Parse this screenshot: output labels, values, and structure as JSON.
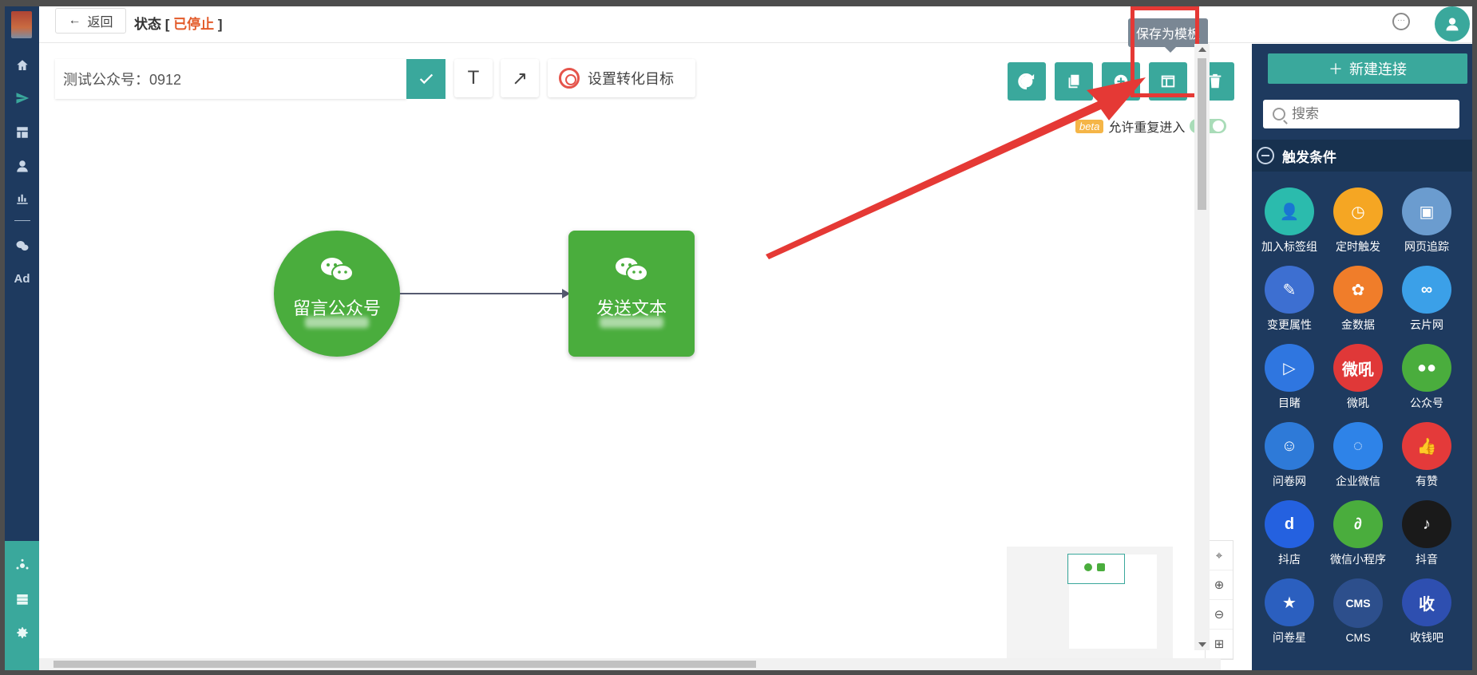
{
  "colors": {
    "primary": "#3aa89c",
    "sidebar": "#1e3a5f",
    "node_green": "#4aad3d",
    "status_stopped": "#e35b2a",
    "annotation_red": "#e53935"
  },
  "header": {
    "back_label": "返回",
    "status_prefix": "状态 [",
    "status_value": "已停止",
    "status_suffix": "]"
  },
  "left_nav": {
    "icons": [
      "home-icon",
      "send-icon",
      "layout-icon",
      "user-icon",
      "chart-icon",
      "wechat-icon",
      "ad-text",
      "hub-icon",
      "server-icon",
      "gear-icon"
    ],
    "ad_label": "Ad"
  },
  "toolbar": {
    "flow_name": "测试公众号：0912",
    "text_tool": "T",
    "arrow_tool": "↗",
    "goal_label": "设置转化目标",
    "tooltip": "保存为模板",
    "beta_badge": "beta",
    "reentry_label": "允许重复进入"
  },
  "flow": {
    "nodes": [
      {
        "label": "留言公众号",
        "shape": "circle"
      },
      {
        "label": "发送文本",
        "shape": "square"
      }
    ]
  },
  "right_panel": {
    "new_connection": "新建连接",
    "search_placeholder": "搜索",
    "section_title": "触发条件",
    "apps": [
      {
        "label": "加入标签组",
        "color": "#2bbbad",
        "glyph": "👤"
      },
      {
        "label": "定时触发",
        "color": "#f5a623",
        "glyph": "◷"
      },
      {
        "label": "网页追踪",
        "color": "#6b9ccf",
        "glyph": "▣"
      },
      {
        "label": "变更属性",
        "color": "#3d6fd1",
        "glyph": "✎"
      },
      {
        "label": "金数据",
        "color": "#f07d2a",
        "glyph": "✿"
      },
      {
        "label": "云片网",
        "color": "#3ba0e8",
        "glyph": "∞"
      },
      {
        "label": "目睹",
        "color": "#2f76e0",
        "glyph": "▷"
      },
      {
        "label": "微吼",
        "color": "#e03838",
        "glyph": "微吼"
      },
      {
        "label": "公众号",
        "color": "#4aad3d",
        "glyph": "●●"
      },
      {
        "label": "问卷网",
        "color": "#2e7ad8",
        "glyph": "☺"
      },
      {
        "label": "企业微信",
        "color": "#2e83e8",
        "glyph": "◌"
      },
      {
        "label": "有赞",
        "color": "#e43a3a",
        "glyph": "👍"
      },
      {
        "label": "抖店",
        "color": "#2461e0",
        "glyph": "d"
      },
      {
        "label": "微信小程序",
        "color": "#4aad3d",
        "glyph": "∂"
      },
      {
        "label": "抖音",
        "color": "#1a1a1a",
        "glyph": "♪"
      },
      {
        "label": "问卷星",
        "color": "#2b5fbf",
        "glyph": "★"
      },
      {
        "label": "CMS",
        "color": "#2d4f8c",
        "glyph": "CMS"
      },
      {
        "label": "收钱吧",
        "color": "#2e4fb0",
        "glyph": "收"
      }
    ]
  },
  "zoom_controls": [
    "locate",
    "zoom-in",
    "zoom-out",
    "fit"
  ]
}
